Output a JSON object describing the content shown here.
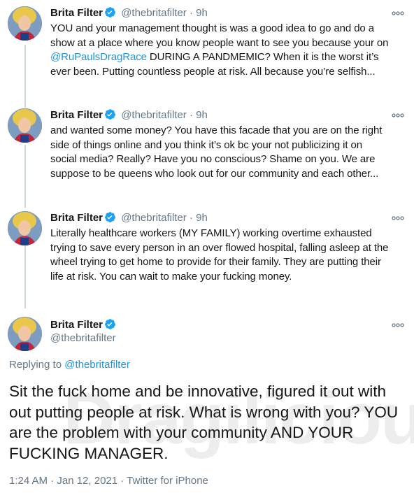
{
  "tweets": [
    {
      "name": "Brita Filter",
      "handle": "@thebritafilter",
      "separator": "·",
      "time": "9h",
      "text_lines": [
        "YOU and your management thought is was a good idea to go and do a",
        "show at a place where you know people want to see you because your on",
        "@RuPaulsDragRace",
        " DURING A PANDMEMIC? When it is the worst it’s",
        "ever been. Putting countless people at risk. All because you’re selfish..."
      ]
    },
    {
      "name": "Brita Filter",
      "handle": "@thebritafilter",
      "separator": "·",
      "time": "9h",
      "text_lines": [
        "and wanted some money? You have this facade that you are on the right",
        "side of things online and you think it’s ok bc your not publicizing it on",
        "social media? Really? Have you no conscious? Shame on you. We are",
        "suppose to be queens who look out for our community and each other..."
      ]
    },
    {
      "name": "Brita Filter",
      "handle": "@thebritafilter",
      "separator": "·",
      "time": "9h",
      "text_lines": [
        "Literally healthcare workers (MY FAMILY) working overtime exhausted",
        "trying to save every person in an over flowed hospital, falling asleep at the",
        "wheel trying to get home to provide for their family. They are putting their",
        "life at risk. You can wait to make your fucking money."
      ]
    }
  ],
  "main_tweet": {
    "name": "Brita Filter",
    "handle": "@thebritafilter",
    "replying_label": "Replying to ",
    "replying_handle": "@thebritafilter",
    "text_lines": [
      "Sit the fuck home and be innovative, figured it out with",
      "out putting people at risk. What is wrong with you? YOU",
      "are the problem with your community AND YOUR",
      "FUCKING MANAGER."
    ],
    "timestamp": "1:24 AM · Jan 12, 2021 · Twitter for iPhone"
  },
  "watermark": "Dragilicious",
  "icons": {
    "verified": "verified-badge-icon",
    "more": "more-options-icon"
  },
  "colors": {
    "verified": "#1da1f2",
    "mention": "#1b95e0",
    "secondary_text": "#657786",
    "thread_line": "#ccd6dd"
  }
}
